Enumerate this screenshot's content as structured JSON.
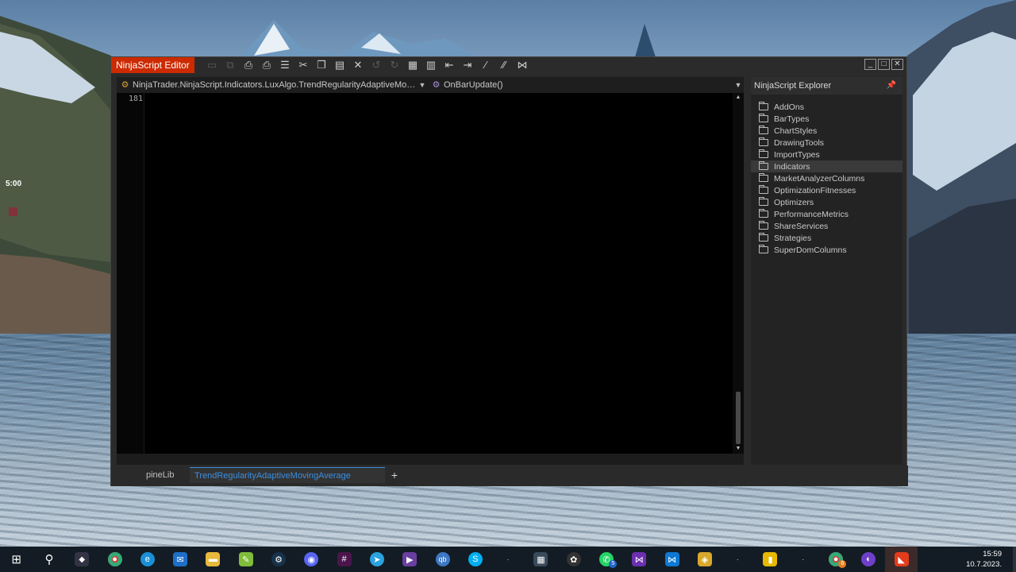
{
  "widget": {
    "timer": "5:00"
  },
  "window": {
    "title": "NinjaScript Editor",
    "toolbar_icons": [
      "save-icon",
      "save-all-icon",
      "print-icon",
      "print-preview-icon",
      "page-setup-icon",
      "cut-icon",
      "copy-icon",
      "paste-icon",
      "delete-icon",
      "undo-icon",
      "redo-icon",
      "find-icon",
      "compile-icon",
      "outdent-icon",
      "indent-icon",
      "comment-icon",
      "uncomment-icon",
      "visual-studio-icon"
    ]
  },
  "editor": {
    "type_selector": "NinjaTrader.NinjaScript.Indicators.LuxAlgo.TrendRegularityAdaptiveMovingA...",
    "member_selector": "OnBarUpdate()",
    "line_number": "181"
  },
  "tabs": [
    {
      "label": "pineLib"
    },
    {
      "label": "TrendRegularityAdaptiveMovingAverage"
    }
  ],
  "explorer": {
    "title": "NinjaScript Explorer",
    "selected": "Indicators",
    "items": [
      "AddOns",
      "BarTypes",
      "ChartStyles",
      "DrawingTools",
      "ImportTypes",
      "Indicators",
      "MarketAnalyzerColumns",
      "OptimizationFitnesses",
      "Optimizers",
      "PerformanceMetrics",
      "ShareServices",
      "Strategies",
      "SuperDomColumns"
    ]
  },
  "taskbar": {
    "apps": [
      "windows-start",
      "search",
      "task-view",
      "chrome",
      "edge",
      "mail",
      "file-explorer",
      "notepad-plus-plus",
      "steam",
      "discord",
      "slack",
      "telegram",
      "visual-studio-preview",
      "qbittorrent",
      "skype",
      "tray-separator",
      "calculator",
      "openai",
      "whatsapp",
      "visual-studio",
      "vscode",
      "app-store",
      "tray-separator-2",
      "sticky-notes",
      "tray-separator-3",
      "chrome-profile",
      "github-desktop",
      "ninjatrader"
    ],
    "badges": {
      "whatsapp": "5",
      "chrome-profile": "6"
    },
    "time": "15:59",
    "date": "10.7.2023."
  }
}
